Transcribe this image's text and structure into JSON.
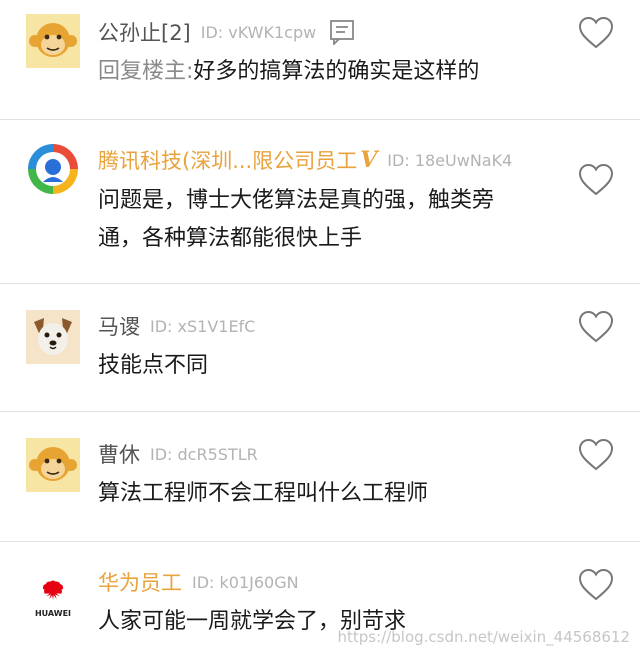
{
  "comments": [
    {
      "name": "公孙止[2]",
      "id": "ID: vKWK1cpw",
      "reply_prefix": "回复楼主:",
      "text": "好多的搞算法的确实是这样的",
      "avatar": "monkey-avatar"
    },
    {
      "name": "腾讯科技(深圳...限公司员工",
      "badge": "V",
      "id": "ID: 18eUwNaK4",
      "text_line1": "问题是，博士大佬算法是真的强，触类旁",
      "text_line2": "通，各种算法都能很快上手",
      "avatar": "tencent-logo"
    },
    {
      "name": "马谡",
      "id": "ID: xS1V1EfC",
      "text": "技能点不同",
      "avatar": "dog-avatar"
    },
    {
      "name": "曹休",
      "id": "ID: dcR5STLR",
      "text": "算法工程师不会工程叫什么工程师",
      "avatar": "monkey-avatar"
    },
    {
      "name": "华为员工",
      "id": "ID: k01J60GN",
      "text": "人家可能一周就学会了，别苛求",
      "avatar": "huawei-logo",
      "logo_text": "HUAWEI"
    }
  ],
  "watermark": "https://blog.csdn.net/weixin_44568612",
  "colors": {
    "employee_name": "#e8a33c",
    "normal_name": "#555555",
    "id_text": "#b3b3b3",
    "divider": "#e3e3e3"
  }
}
